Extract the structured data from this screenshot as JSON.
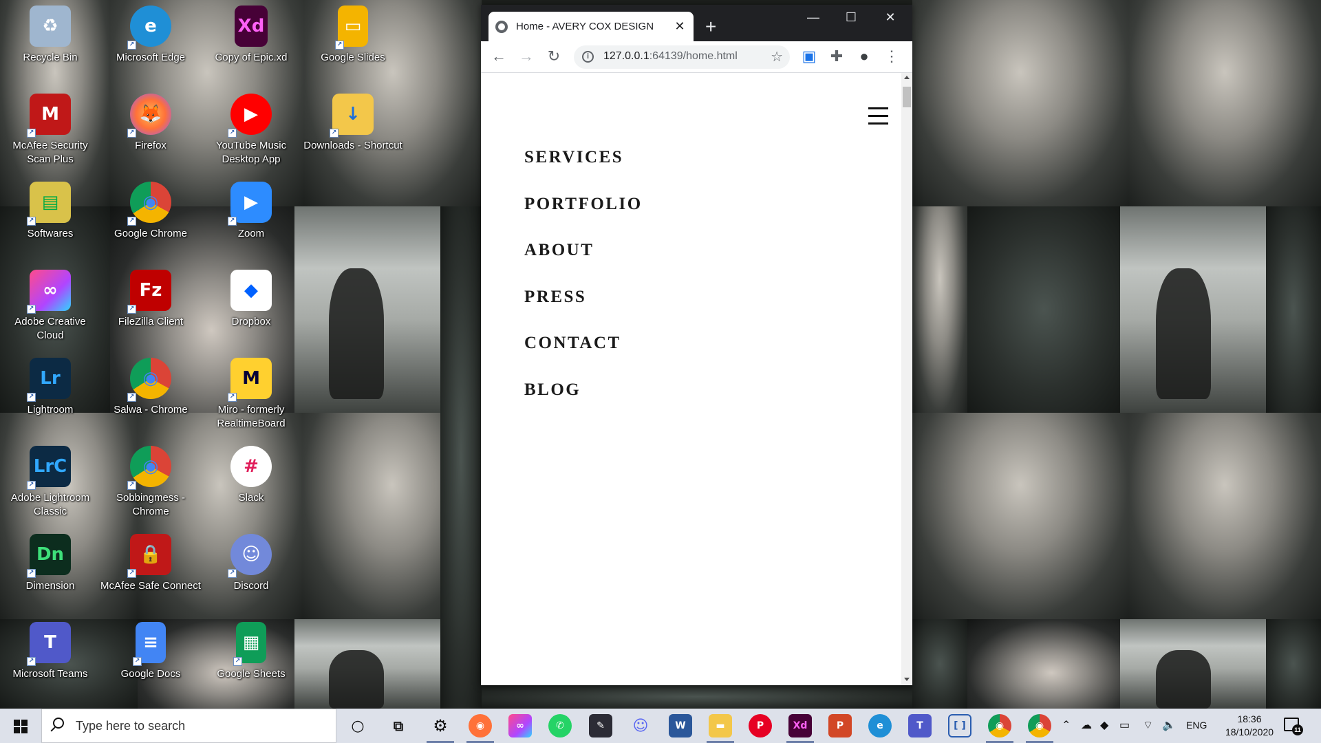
{
  "desktop": {
    "icons": [
      {
        "label": "Recycle Bin",
        "icon": "recycle-bin-icon",
        "color": "#9fb6cf",
        "glyph": "♻"
      },
      {
        "label": "Microsoft Edge",
        "icon": "edge-icon",
        "color": "#1f8fd6",
        "glyph": "e"
      },
      {
        "label": "Copy of Epic.xd",
        "icon": "adobe-xd-icon",
        "color": "#470137",
        "glyph": "Xd"
      },
      {
        "label": "Google Slides",
        "icon": "google-slides-icon",
        "color": "#f4b400",
        "glyph": "▭"
      },
      {
        "label": "McAfee Security Scan Plus",
        "icon": "mcafee-icon",
        "color": "#c01818",
        "glyph": "M"
      },
      {
        "label": "Firefox",
        "icon": "firefox-icon",
        "color": "#ff7139",
        "glyph": "🦊"
      },
      {
        "label": "YouTube Music Desktop App",
        "icon": "youtube-music-icon",
        "color": "#ff0000",
        "glyph": "▶"
      },
      {
        "label": "Downloads - Shortcut",
        "icon": "downloads-folder-icon",
        "color": "#f3c74a",
        "glyph": "↓"
      },
      {
        "label": "Softwares",
        "icon": "softwares-icon",
        "color": "#d9c24a",
        "glyph": "▤"
      },
      {
        "label": "Google Chrome",
        "icon": "chrome-icon",
        "color": "#4285f4",
        "glyph": "◉"
      },
      {
        "label": "Zoom",
        "icon": "zoom-icon",
        "color": "#2d8cff",
        "glyph": "▶"
      },
      {
        "label": "Adobe Creative Cloud",
        "icon": "creative-cloud-icon",
        "color": "#e8334b",
        "glyph": "∞"
      },
      {
        "label": "FileZilla Client",
        "icon": "filezilla-icon",
        "color": "#bf0000",
        "glyph": "Fz"
      },
      {
        "label": "Dropbox",
        "icon": "dropbox-icon",
        "color": "#ffffff",
        "glyph": "◆"
      },
      {
        "label": "Lightroom",
        "icon": "lightroom-icon",
        "color": "#0c2a44",
        "glyph": "Lr"
      },
      {
        "label": "Salwa - Chrome",
        "icon": "chrome-profile-icon",
        "color": "#4285f4",
        "glyph": "◉"
      },
      {
        "label": "Miro - formerly RealtimeBoard",
        "icon": "miro-icon",
        "color": "#ffd02f",
        "glyph": "M"
      },
      {
        "label": "Adobe Lightroom Classic",
        "icon": "lightroom-classic-icon",
        "color": "#0c2a44",
        "glyph": "LrC"
      },
      {
        "label": "Sobbingmess - Chrome",
        "icon": "chrome-profile-icon",
        "color": "#4285f4",
        "glyph": "◉"
      },
      {
        "label": "Slack",
        "icon": "slack-icon",
        "color": "#ffffff",
        "glyph": "#"
      },
      {
        "label": "Dimension",
        "icon": "dimension-icon",
        "color": "#0c2d1e",
        "glyph": "Dn"
      },
      {
        "label": "McAfee Safe Connect",
        "icon": "mcafee-safe-connect-icon",
        "color": "#c01818",
        "glyph": "🔒"
      },
      {
        "label": "Discord",
        "icon": "discord-icon",
        "color": "#7289da",
        "glyph": "☺"
      },
      {
        "label": "Microsoft Teams",
        "icon": "teams-icon",
        "color": "#5059c9",
        "glyph": "T"
      },
      {
        "label": "Google Docs",
        "icon": "google-docs-icon",
        "color": "#4285f4",
        "glyph": "≡"
      },
      {
        "label": "Google Sheets",
        "icon": "google-sheets-icon",
        "color": "#0f9d58",
        "glyph": "▦"
      }
    ]
  },
  "browser": {
    "tab_title": "Home - AVERY COX DESIGN",
    "tab_close": "✕",
    "new_tab": "+",
    "url_host": "127.0.0.1",
    "url_rest": ":64139/home.html",
    "minimize": "—",
    "maximize": "☐",
    "close": "✕"
  },
  "site": {
    "nav": [
      "SERVICES",
      "PORTFOLIO",
      "ABOUT",
      "PRESS",
      "CONTACT",
      "BLOG"
    ]
  },
  "taskbar": {
    "search_placeholder": "Type here to search",
    "apps": [
      {
        "name": "cortana-icon",
        "color": "#dde1ea",
        "glyph": "○",
        "fg": "#111"
      },
      {
        "name": "task-view-icon",
        "color": "#dde1ea",
        "glyph": "⧉",
        "fg": "#111"
      },
      {
        "name": "settings-icon",
        "color": "#dde1ea",
        "glyph": "⚙",
        "fg": "#111"
      },
      {
        "name": "firefox-icon",
        "color": "#ff7139",
        "glyph": "◉",
        "fg": "#fff"
      },
      {
        "name": "creative-cloud-icon",
        "color": "#e8334b",
        "glyph": "∞",
        "fg": "#fff"
      },
      {
        "name": "whatsapp-icon",
        "color": "#25d366",
        "glyph": "✆",
        "fg": "#fff"
      },
      {
        "name": "pen-app-icon",
        "color": "#2b2b35",
        "glyph": "✎",
        "fg": "#fff"
      },
      {
        "name": "discord-icon",
        "color": "#dde1ea",
        "glyph": "☺",
        "fg": "#5865f2"
      },
      {
        "name": "word-icon",
        "color": "#2b579a",
        "glyph": "W",
        "fg": "#fff"
      },
      {
        "name": "file-explorer-icon",
        "color": "#f3c74a",
        "glyph": "▬",
        "fg": "#fff"
      },
      {
        "name": "pinterest-icon",
        "color": "#e60023",
        "glyph": "P",
        "fg": "#fff"
      },
      {
        "name": "adobe-xd-icon",
        "color": "#470137",
        "glyph": "Xd",
        "fg": "#ff61f6"
      },
      {
        "name": "powerpoint-icon",
        "color": "#d24726",
        "glyph": "P",
        "fg": "#fff"
      },
      {
        "name": "edge-icon",
        "color": "#1f8fd6",
        "glyph": "e",
        "fg": "#fff"
      },
      {
        "name": "teams-icon",
        "color": "#5059c9",
        "glyph": "T",
        "fg": "#fff"
      },
      {
        "name": "bracket-app-icon",
        "color": "#dde1ea",
        "glyph": "[ ]",
        "fg": "#2a5db0"
      },
      {
        "name": "chrome-profile-icon",
        "color": "#4285f4",
        "glyph": "◉",
        "fg": "#fff"
      },
      {
        "name": "chrome-icon",
        "color": "#4285f4",
        "glyph": "◉",
        "fg": "#fff"
      }
    ],
    "tray_lang": "ENG",
    "time": "18:36",
    "date": "18/10/2020",
    "notif_count": "11"
  }
}
